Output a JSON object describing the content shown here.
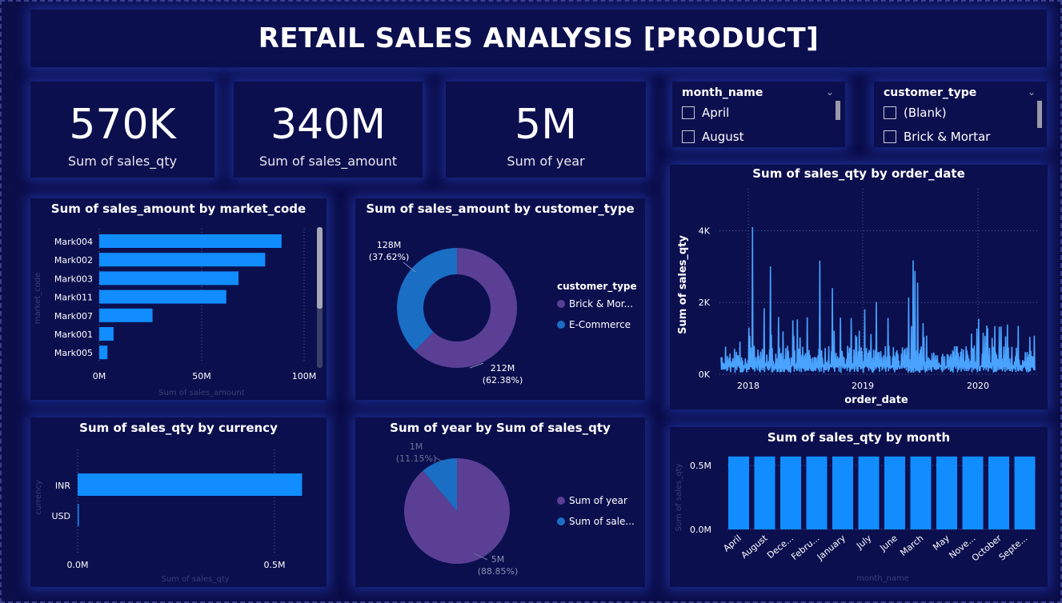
{
  "title": "RETAIL SALES ANALYSIS [PRODUCT]",
  "kpis": [
    {
      "value": "570K",
      "label": "Sum of sales_qty"
    },
    {
      "value": "340M",
      "label": "Sum of sales_amount"
    },
    {
      "value": "5M",
      "label": "Sum of year"
    }
  ],
  "slicers": {
    "month": {
      "header": "month_name",
      "items": [
        "April",
        "August"
      ]
    },
    "customer": {
      "header": "customer_type",
      "items": [
        "(Blank)",
        "Brick & Mortar"
      ]
    }
  },
  "colors": {
    "bar": "#118dff",
    "purple": "#5a3f95",
    "blue": "#1a6ec4",
    "line": "#4aa3ff"
  },
  "chart_data": [
    {
      "id": "market",
      "type": "bar",
      "orientation": "horizontal",
      "title": "Sum of sales_amount by market_code",
      "xlabel": "Sum of sales_amount",
      "ylabel": "market_code",
      "categories": [
        "Mark004",
        "Mark002",
        "Mark003",
        "Mark011",
        "Mark007",
        "Mark001",
        "Mark005"
      ],
      "values": [
        89,
        81,
        68,
        62,
        26,
        7,
        4
      ],
      "xticks": [
        "0M",
        "50M",
        "100M"
      ],
      "xlim": [
        0,
        100
      ]
    },
    {
      "id": "customer_donut",
      "type": "pie",
      "title": "Sum of sales_amount by customer_type",
      "legend_title": "customer_type",
      "categories": [
        "Brick & Mor...",
        "E-Commerce"
      ],
      "values": [
        212,
        128
      ],
      "labels": [
        [
          "212M",
          "(62.38%)"
        ],
        [
          "128M",
          "(37.62%)"
        ]
      ]
    },
    {
      "id": "order_date",
      "type": "line",
      "title": "Sum of sales_qty by order_date",
      "xlabel": "order_date",
      "ylabel": "Sum of sales_qty",
      "xticks": [
        "2018",
        "2019",
        "2020"
      ],
      "yticks": [
        "0K",
        "2K",
        "4K"
      ],
      "ylim": [
        0,
        4500
      ],
      "note": "daily series approx. Oct 2017 - Jun 2020, peak ~4.1K"
    },
    {
      "id": "currency",
      "type": "bar",
      "orientation": "horizontal",
      "title": "Sum of sales_qty by currency",
      "xlabel": "Sum of sales_qty",
      "ylabel": "currency",
      "categories": [
        "INR",
        "USD"
      ],
      "values": [
        0.57,
        0.002
      ],
      "xticks": [
        "0.0M",
        "0.5M"
      ],
      "xlim": [
        0,
        0.5
      ]
    },
    {
      "id": "year_pie",
      "type": "pie",
      "title": "Sum of year by Sum of sales_qty",
      "categories": [
        "Sum of year",
        "Sum of sale..."
      ],
      "values": [
        88.85,
        11.15
      ],
      "labels": [
        [
          "5M",
          "(88.85%)"
        ],
        [
          "1M",
          "(11.15%)"
        ]
      ]
    },
    {
      "id": "month",
      "type": "bar",
      "title": "Sum of sales_qty by month",
      "xlabel": "month_name",
      "ylabel": "Sum of sales_qty",
      "categories": [
        "April",
        "August",
        "Dece...",
        "Febru...",
        "January",
        "July",
        "June",
        "March",
        "May",
        "Nove...",
        "October",
        "Septe..."
      ],
      "values": [
        0.57,
        0.57,
        0.57,
        0.57,
        0.57,
        0.57,
        0.57,
        0.57,
        0.57,
        0.57,
        0.57,
        0.57
      ],
      "yticks": [
        "0.0M",
        "0.5M"
      ],
      "ylim": [
        0,
        0.5
      ]
    }
  ]
}
